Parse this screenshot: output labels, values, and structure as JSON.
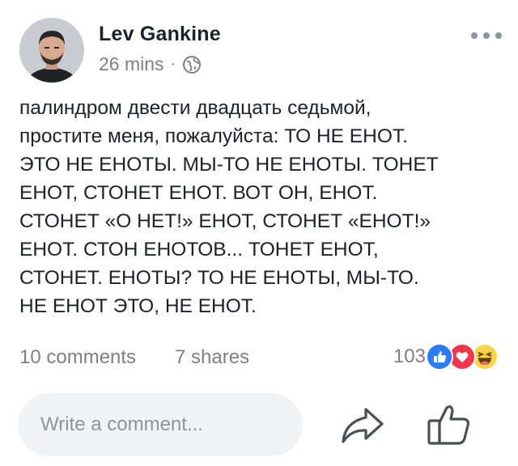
{
  "post": {
    "author": "Lev Gankine",
    "time": "26 mins",
    "separator": "·",
    "privacy_icon": "globe-icon",
    "more_icon": "more-options-icon",
    "body_lines": [
      "палиндром двести двадцать седьмой,",
      "простите меня, пожалуйста: ТО НЕ ЕНОТ.",
      "ЭТО НЕ ЕНОТЫ. МЫ-ТО НЕ ЕНОТЫ. ТОНЕТ",
      "ЕНОТ, СТОНЕТ ЕНОТ. ВОТ ОН, ЕНОТ.",
      "СТОНЕТ «О НЕТ!» ЕНОТ, СТОНЕТ «ЕНОТ!»",
      "ЕНОТ. СТОН ЕНОТОВ... ТОНЕТ ЕНОТ,",
      "СТОНЕТ. ЕНОТЫ? ТО НЕ ЕНОТЫ, МЫ-ТО.",
      "НЕ ЕНОТ ЭТО, НЕ ЕНОТ."
    ]
  },
  "stats": {
    "comments": "10 comments",
    "shares": "7 shares",
    "reactions_count": "103",
    "reaction_icons": [
      "like-icon",
      "love-icon",
      "haha-icon"
    ]
  },
  "composer": {
    "placeholder": "Write a comment...",
    "share_icon": "share-arrow-icon",
    "like_icon": "thumbs-up-icon"
  },
  "colors": {
    "text": "#1d2129",
    "muted": "#7f7f7f",
    "like_blue": "#2b7cf6",
    "love_red": "#f0364f",
    "haha_yellow": "#fcd34a",
    "input_bg": "#f2f3f5"
  }
}
